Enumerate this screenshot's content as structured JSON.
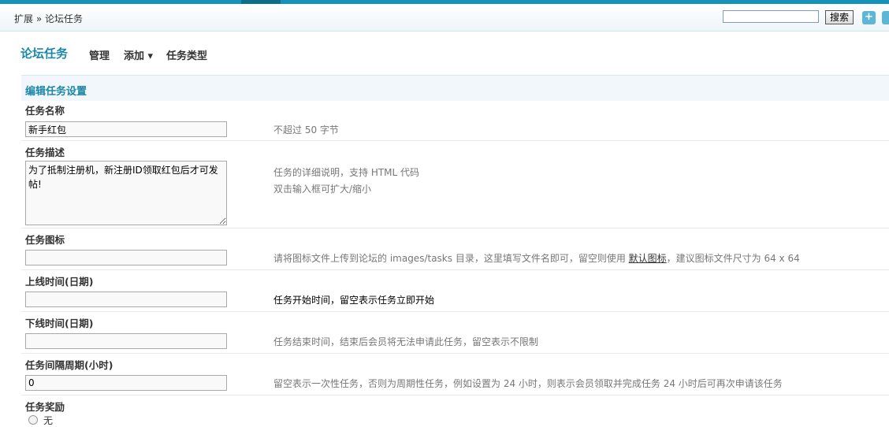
{
  "breadcrumb": {
    "root": "扩展",
    "separator": " » ",
    "current": "论坛任务"
  },
  "search": {
    "placeholder": "",
    "value": "",
    "button": "搜索"
  },
  "header_icons": [
    "plus-icon",
    "extra-icon"
  ],
  "page": {
    "title": "论坛任务",
    "nav": [
      {
        "label": "管理"
      },
      {
        "label": "添加 ▾"
      },
      {
        "label": "任务类型"
      }
    ]
  },
  "section": {
    "title": "编辑任务设置"
  },
  "fields": {
    "name": {
      "label": "任务名称",
      "value": "新手红包",
      "hint": "不超过 50 字节"
    },
    "description": {
      "label": "任务描述",
      "value": "为了抵制注册机，新注册ID领取红包后才可发帖!",
      "hint1": "任务的详细说明，支持 HTML 代码",
      "hint2": "双击输入框可扩大/缩小"
    },
    "icon": {
      "label": "任务图标",
      "value": "",
      "hint_before": "请将图标文件上传到论坛的 images/tasks 目录，这里填写文件名即可，留空则使用 ",
      "hint_link": "默认图标",
      "hint_after": "，建议图标文件尺寸为 64 x 64"
    },
    "start_time": {
      "label": "上线时间(日期)",
      "value": "",
      "hint": "任务开始时间，留空表示任务立即开始"
    },
    "end_time": {
      "label": "下线时间(日期)",
      "value": "",
      "hint": "任务结束时间，结束后会员将无法申请此任务，留空表示不限制"
    },
    "period": {
      "label": "任务间隔周期(小时)",
      "value": "0",
      "hint": "留空表示一次性任务，否则为周期性任务，例如设置为 24 小时，则表示会员领取并完成任务 24 小时后可再次申请该任务"
    },
    "reward": {
      "label": "任务奖励",
      "option_label": "无"
    }
  }
}
